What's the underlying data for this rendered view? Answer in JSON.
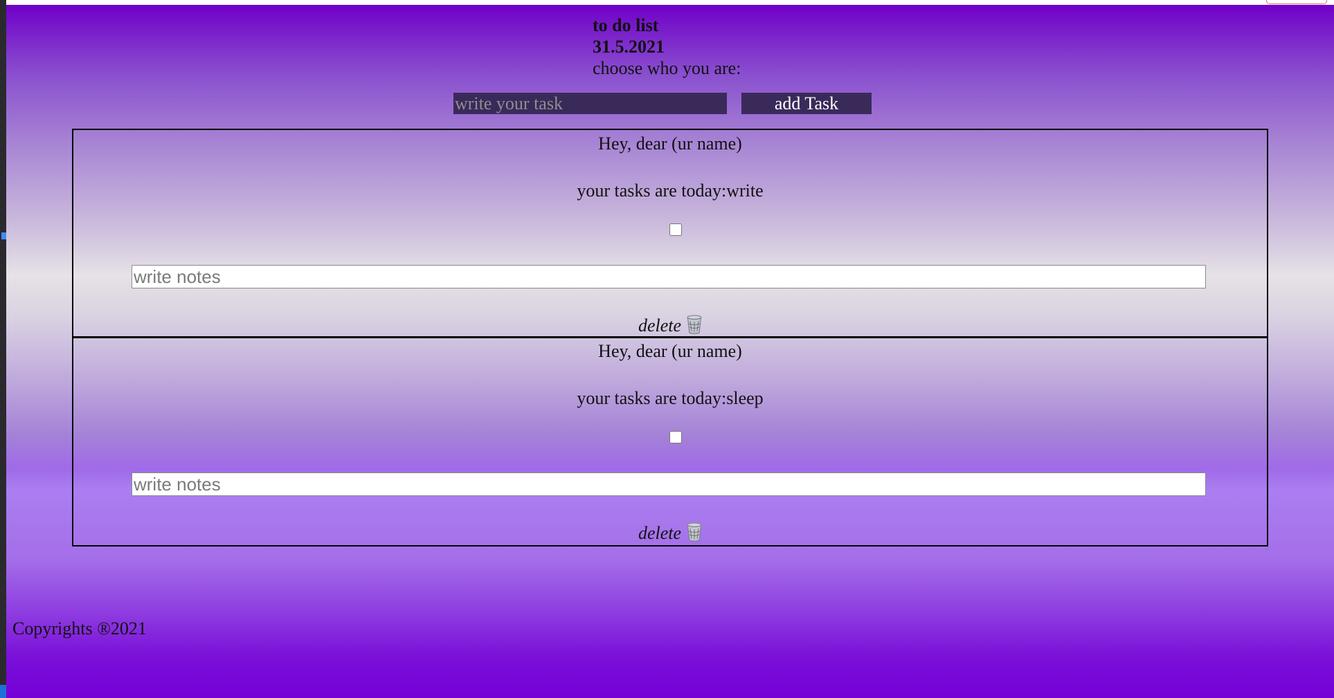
{
  "header": {
    "title": "to do list",
    "date": "31.5.2021",
    "prompt": "choose who you are:"
  },
  "task_form": {
    "input_placeholder": "write your task",
    "add_label": "add Task"
  },
  "tasks": [
    {
      "greeting": "Hey, dear (ur name)",
      "task_text": "your tasks are today:write",
      "completed": false,
      "notes_placeholder": "write notes",
      "delete_label": "delete",
      "delete_icon": "wastebasket-icon"
    },
    {
      "greeting": "Hey, dear (ur name)",
      "task_text": "your tasks are today:sleep",
      "completed": false,
      "notes_placeholder": "write notes",
      "delete_label": "delete",
      "delete_icon": "wastebasket-icon"
    }
  ],
  "footer": {
    "copyright": "Copyrights ®2021"
  },
  "colors": {
    "gradient_top": "#7000c8",
    "gradient_mid": "#e6e2e6",
    "gradient_bottom": "#7400d6",
    "input_bg": "#3a2a5a"
  }
}
